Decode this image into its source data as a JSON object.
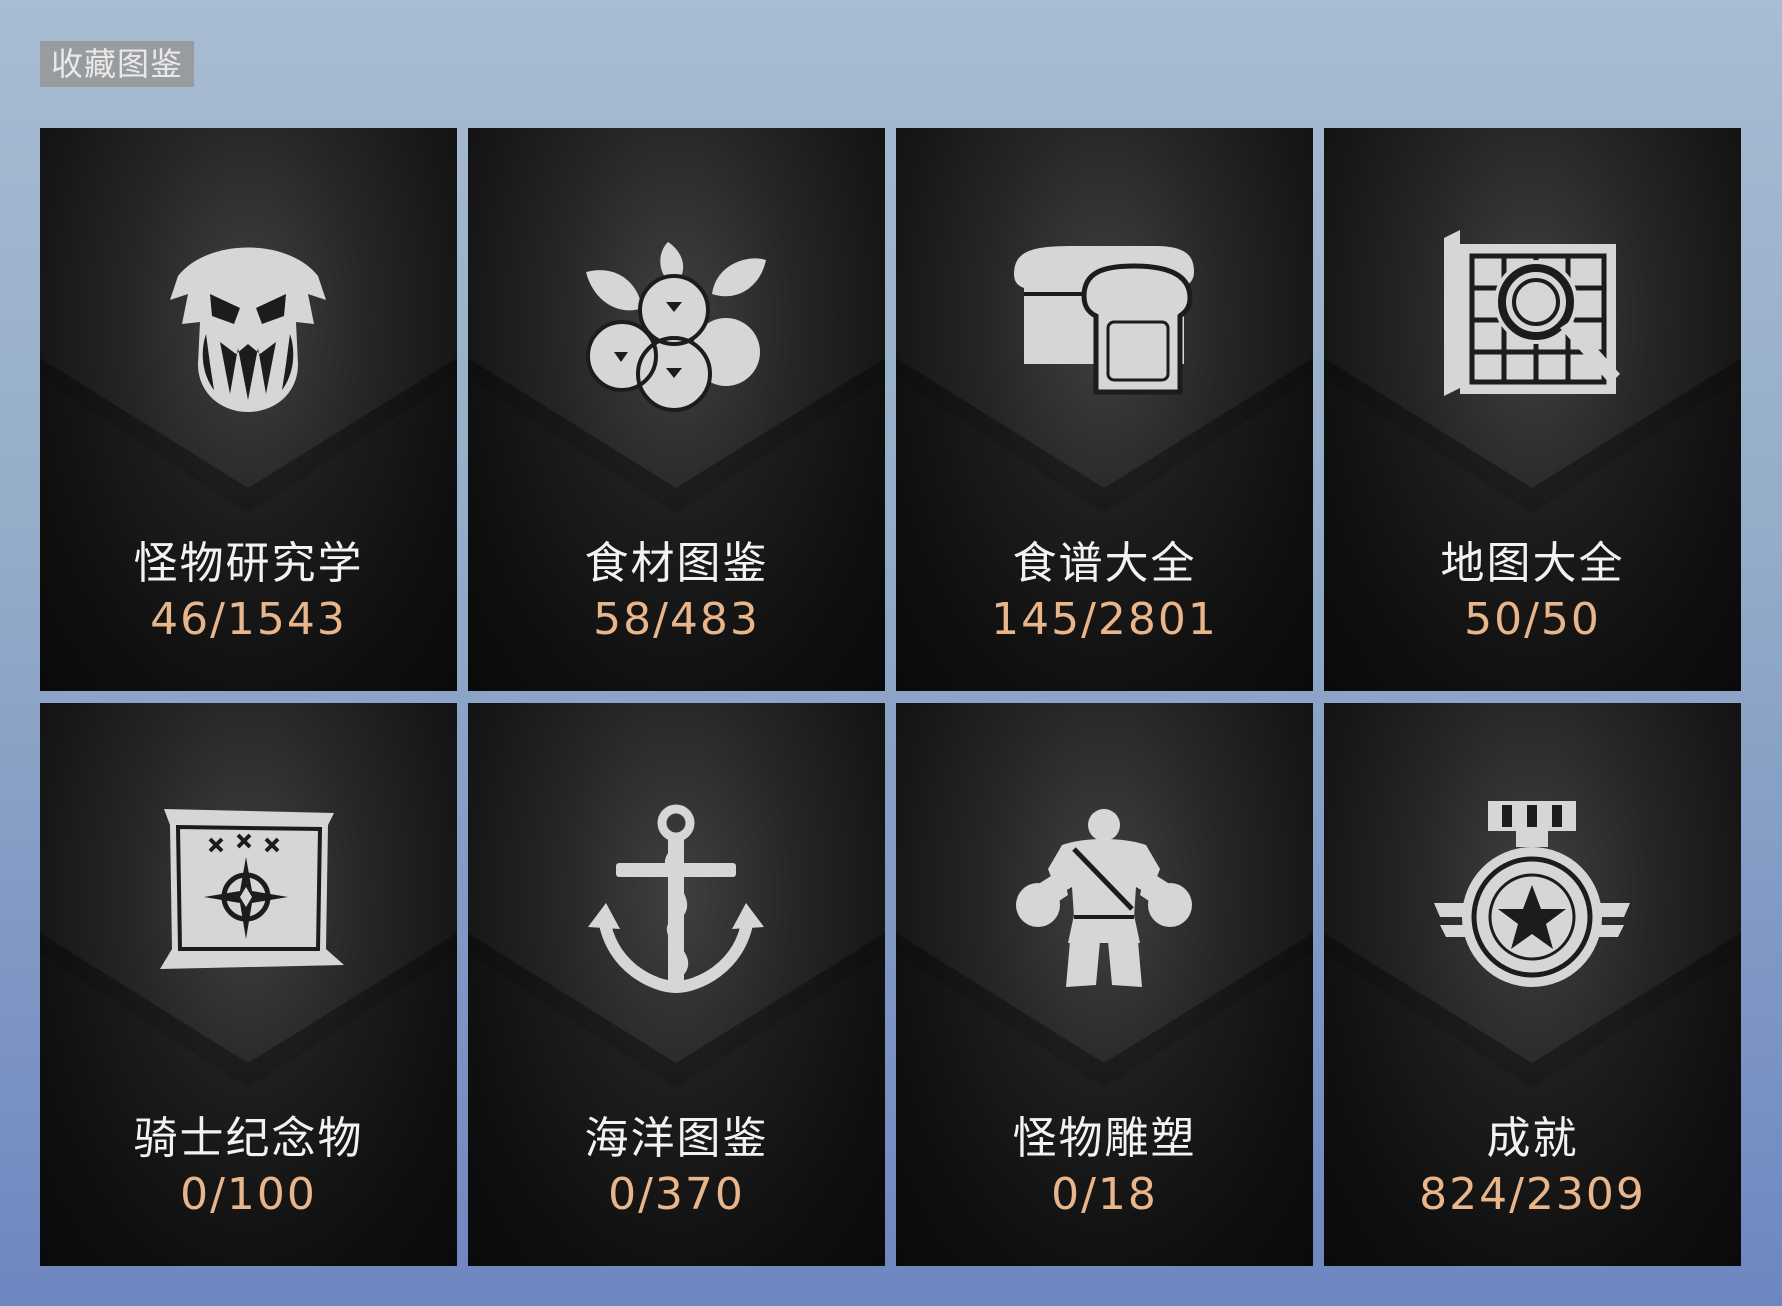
{
  "header": {
    "title": "收藏图鉴"
  },
  "cards": [
    {
      "title": "怪物研究学",
      "count": "46/1543",
      "icon": "monster-skull-icon"
    },
    {
      "title": "食材图鉴",
      "count": "58/483",
      "icon": "berries-icon"
    },
    {
      "title": "食谱大全",
      "count": "145/2801",
      "icon": "bread-icon"
    },
    {
      "title": "地图大全",
      "count": "50/50",
      "icon": "map-magnifier-icon"
    },
    {
      "title": "骑士纪念物",
      "count": "0/100",
      "icon": "scroll-compass-icon"
    },
    {
      "title": "海洋图鉴",
      "count": "0/370",
      "icon": "anchor-icon"
    },
    {
      "title": "怪物雕塑",
      "count": "0/18",
      "icon": "brute-statue-icon"
    },
    {
      "title": "成就",
      "count": "824/2309",
      "icon": "medal-icon"
    }
  ],
  "colors": {
    "count_text": "#e9b58a",
    "title_text": "#f2f2f2",
    "card_bg": "#1a1a1a",
    "page_bg": "#95adc9"
  }
}
